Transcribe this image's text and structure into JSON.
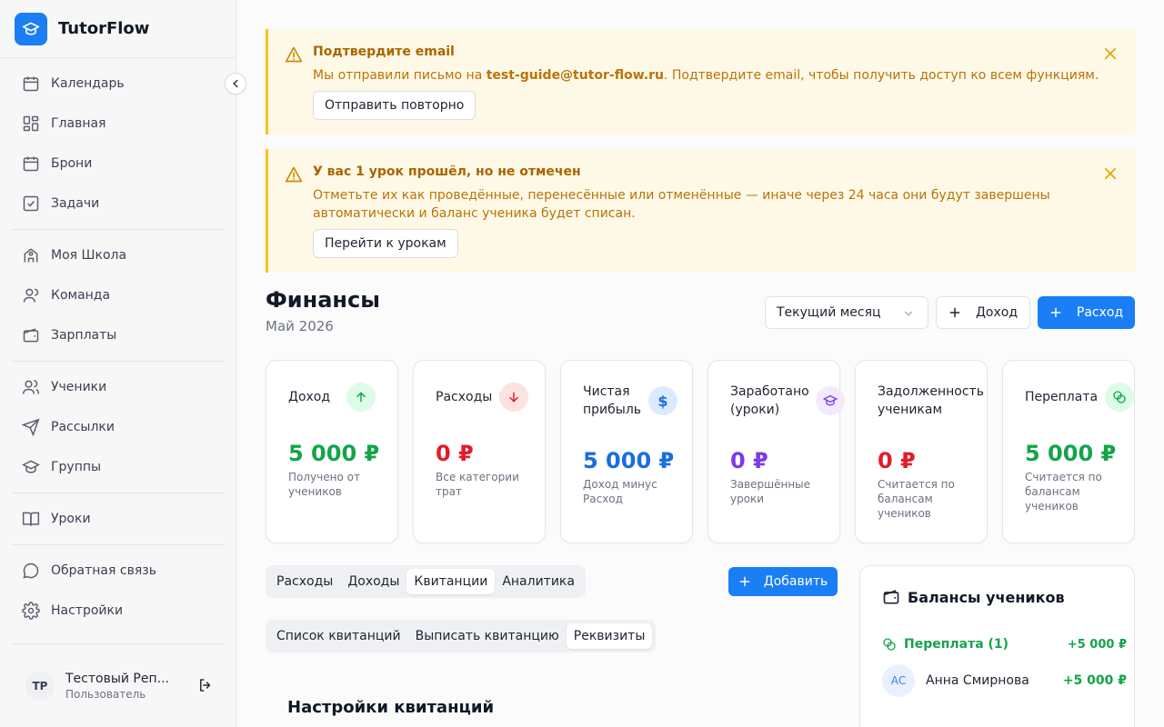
{
  "app": {
    "name": "TutorFlow"
  },
  "sidebar": {
    "items": [
      {
        "label": "Календарь",
        "icon": "calendar-icon"
      },
      {
        "label": "Главная",
        "icon": "dashboard-icon"
      },
      {
        "label": "Брони",
        "icon": "calendar-icon"
      },
      {
        "label": "Задачи",
        "icon": "checkbox-icon"
      },
      {
        "label": "Моя Школа",
        "icon": "school-icon"
      },
      {
        "label": "Команда",
        "icon": "user-icon"
      },
      {
        "label": "Зарплаты",
        "icon": "wallet-icon"
      },
      {
        "label": "Ученики",
        "icon": "users-icon"
      },
      {
        "label": "Рассылки",
        "icon": "send-icon"
      },
      {
        "label": "Группы",
        "icon": "graduation-cap-icon"
      },
      {
        "label": "Уроки",
        "icon": "book-icon"
      },
      {
        "label": "Обратная связь",
        "icon": "chat-icon"
      },
      {
        "label": "Настройки",
        "icon": "gear-icon"
      }
    ],
    "user": {
      "initials": "TP",
      "name": "Тестовый Реп...",
      "role": "Пользователь"
    }
  },
  "alerts": [
    {
      "title": "Подтвердите email",
      "text_before": "Мы отправили письмо на ",
      "email": "test-guide@tutor-flow.ru",
      "text_after": ". Подтвердите email, чтобы получить доступ ко всем функциям.",
      "button": "Отправить повторно"
    },
    {
      "title": "У вас 1 урок прошёл, но не отмечен",
      "text": "Отметьте их как проведённые, перенесённые или отменённые — иначе через 24 часа они будут завершены автоматически и баланс ученика будет списан.",
      "button": "Перейти к урокам"
    }
  ],
  "page": {
    "title": "Финансы",
    "subtitle": "Май 2026"
  },
  "header": {
    "period": "Текущий месяц",
    "income_button": "Доход",
    "expense_button": "Расход"
  },
  "colors": {
    "accent": "#1a7ef5",
    "green": "#15a34a",
    "red": "#e11d2b",
    "warning_bg": "#fef9e6",
    "warning_border": "#f5c518"
  },
  "stats": [
    {
      "label": "Доход",
      "value": "5 000 ₽",
      "desc": "Получено от учеников",
      "icon": "arrow-up-icon"
    },
    {
      "label": "Расходы",
      "value": "0 ₽",
      "desc": "Все категории трат",
      "icon": "arrow-down-icon"
    },
    {
      "label": "Чистая прибыль",
      "value": "5 000 ₽",
      "desc": "Доход минус Расход",
      "icon": "dollar-icon"
    },
    {
      "label": "Заработано (уроки)",
      "value": "0 ₽",
      "desc": "Завершённые уроки",
      "icon": "graduation-cap-icon"
    },
    {
      "label": "Задолженность ученикам",
      "value": "0 ₽",
      "desc": "Считается по балансам учеников",
      "icon": "alert-icon"
    },
    {
      "label": "Переплата",
      "value": "5 000 ₽",
      "desc": "Считается по балансам учеников",
      "icon": "coins-icon"
    }
  ],
  "tabs": {
    "main": [
      "Расходы",
      "Доходы",
      "Квитанции",
      "Аналитика"
    ],
    "main_active": "Квитанции",
    "sub": [
      "Список квитанций",
      "Выписать квитанцию",
      "Реквизиты"
    ],
    "sub_active": "Реквизиты",
    "add_button": "Добавить"
  },
  "section": {
    "title": "Настройки квитанций"
  },
  "balances": {
    "title": "Балансы учеников",
    "overpay_label": "Переплата (1)",
    "overpay_total": "+5 000 ₽",
    "rows": [
      {
        "initials": "АС",
        "name": "Анна Смирнова",
        "amount": "+5 000 ₽"
      }
    ]
  }
}
